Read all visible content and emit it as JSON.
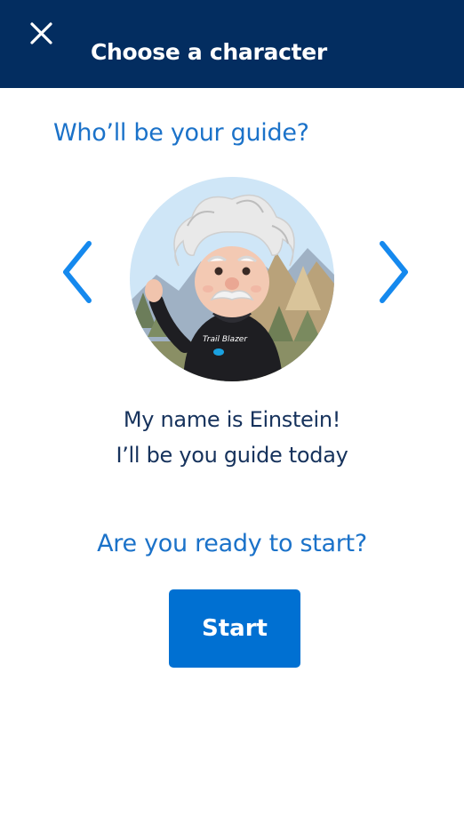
{
  "header": {
    "title": "Choose a character",
    "close_icon": "close-icon"
  },
  "main": {
    "question": "Who’ll be your guide?",
    "character_name": "Einstein",
    "intro_line_1": "My name is Einstein!",
    "intro_line_2": "I’ll be you guide today",
    "ready_prompt": "Are you ready to start?",
    "start_label": "Start"
  },
  "colors": {
    "header_bg": "#032d60",
    "accent": "#1b72c9",
    "button_bg": "#0070d2",
    "body_text": "#16325c"
  }
}
